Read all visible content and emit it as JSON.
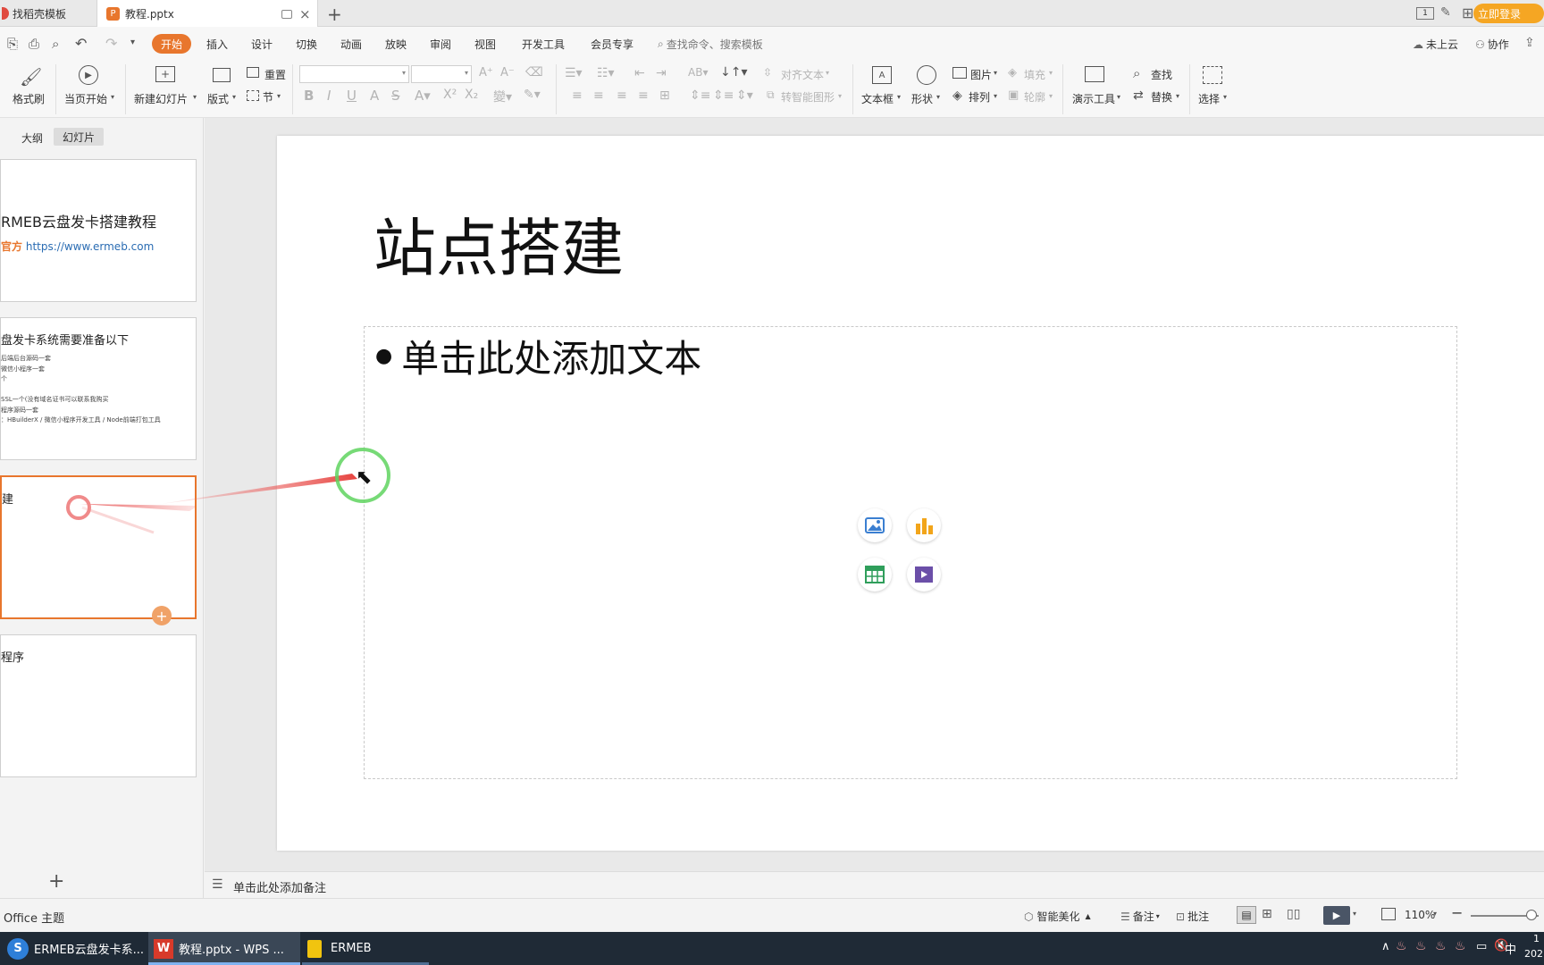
{
  "tabs": [
    {
      "label": "找稻壳模板"
    },
    {
      "label": "教程.pptx"
    }
  ],
  "login_button": "立即登录",
  "menu": {
    "start": "开始",
    "items": [
      "插入",
      "设计",
      "切换",
      "动画",
      "放映",
      "审阅",
      "视图",
      "开发工具",
      "会员专享"
    ],
    "search_placeholder": "查找命令、搜索模板",
    "cloud": "未上云",
    "collab": "协作"
  },
  "ribbon": {
    "format_painter": "格式刷",
    "play_from_current": "当页开始",
    "new_slide": "新建幻灯片",
    "layout": "版式",
    "reset": "重置",
    "section": "节",
    "align_text": "对齐文本",
    "smart_art": "转智能图形",
    "textbox": "文本框",
    "shapes": "形状",
    "picture": "图片",
    "fill": "填充",
    "arrange": "排列",
    "outline": "轮廓",
    "present_tools": "演示工具",
    "find": "查找",
    "replace": "替换",
    "select": "选择"
  },
  "panel_tabs": {
    "outline": "大纲",
    "slides": "幻灯片"
  },
  "thumbnails": {
    "s1_title": "RMEB云盘发卡搭建教程",
    "s1_label": "官方",
    "s1_url": "https://www.ermeb.com",
    "s2_title": "盘发卡系统需要准备以下",
    "s2_lines": [
      "后端后台源码一套",
      "微信小程序一套",
      "个",
      "",
      "SSL一个(没有域名证书可以联系我购买",
      "程序源码一套",
      "：HBuilderX / 微信小程序开发工具 / Node前端打包工具"
    ],
    "s3_title": "建",
    "s4_title": "程序"
  },
  "slide": {
    "title": "站点搭建",
    "placeholder": "单击此处添加文本"
  },
  "notes_placeholder": "单击此处添加备注",
  "status": {
    "theme": "Office 主题",
    "beautify": "智能美化",
    "notes": "备注",
    "comments": "批注",
    "zoom": "110%"
  },
  "taskbar": {
    "app1": "ERMEB云盘发卡系...",
    "app2": "教程.pptx - WPS ...",
    "app3": "ERMEB",
    "ime": "中",
    "clock_top": "1",
    "clock_bottom": "202"
  },
  "colors": {
    "accent": "#e8762d",
    "login": "#f5a623",
    "selected_border": "#e8762d",
    "cursor_ring": "#5fd35f"
  }
}
